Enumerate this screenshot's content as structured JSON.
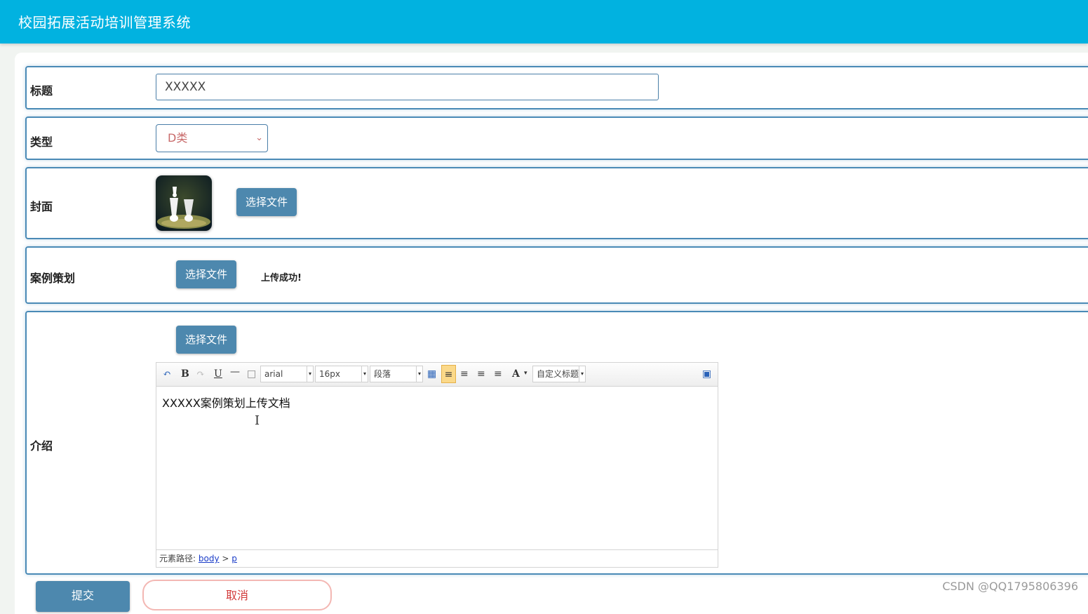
{
  "app": {
    "title": "校园拓展活动培训管理系统"
  },
  "form": {
    "title_row": {
      "label": "标题",
      "value": "XXXXX"
    },
    "type_row": {
      "label": "类型",
      "selected": "D类"
    },
    "cover_row": {
      "label": "封面",
      "upload_label": "选择文件"
    },
    "plan_row": {
      "label": "案例策划",
      "upload_label": "选择文件",
      "status": "上传成功!"
    },
    "intro_row": {
      "label": "介绍",
      "upload_label": "选择文件",
      "editor": {
        "font_family": "arial",
        "font_size": "16px",
        "paragraph": "段落",
        "custom_title": "自定义标题",
        "content": "XXXXX案例策划上传文档",
        "path_label": "元素路径:",
        "path_body": "body",
        "path_sep": ">",
        "path_p": "p"
      }
    },
    "submit_label": "提交",
    "cancel_label": "取消"
  },
  "watermark": "CSDN @QQ1795806396"
}
